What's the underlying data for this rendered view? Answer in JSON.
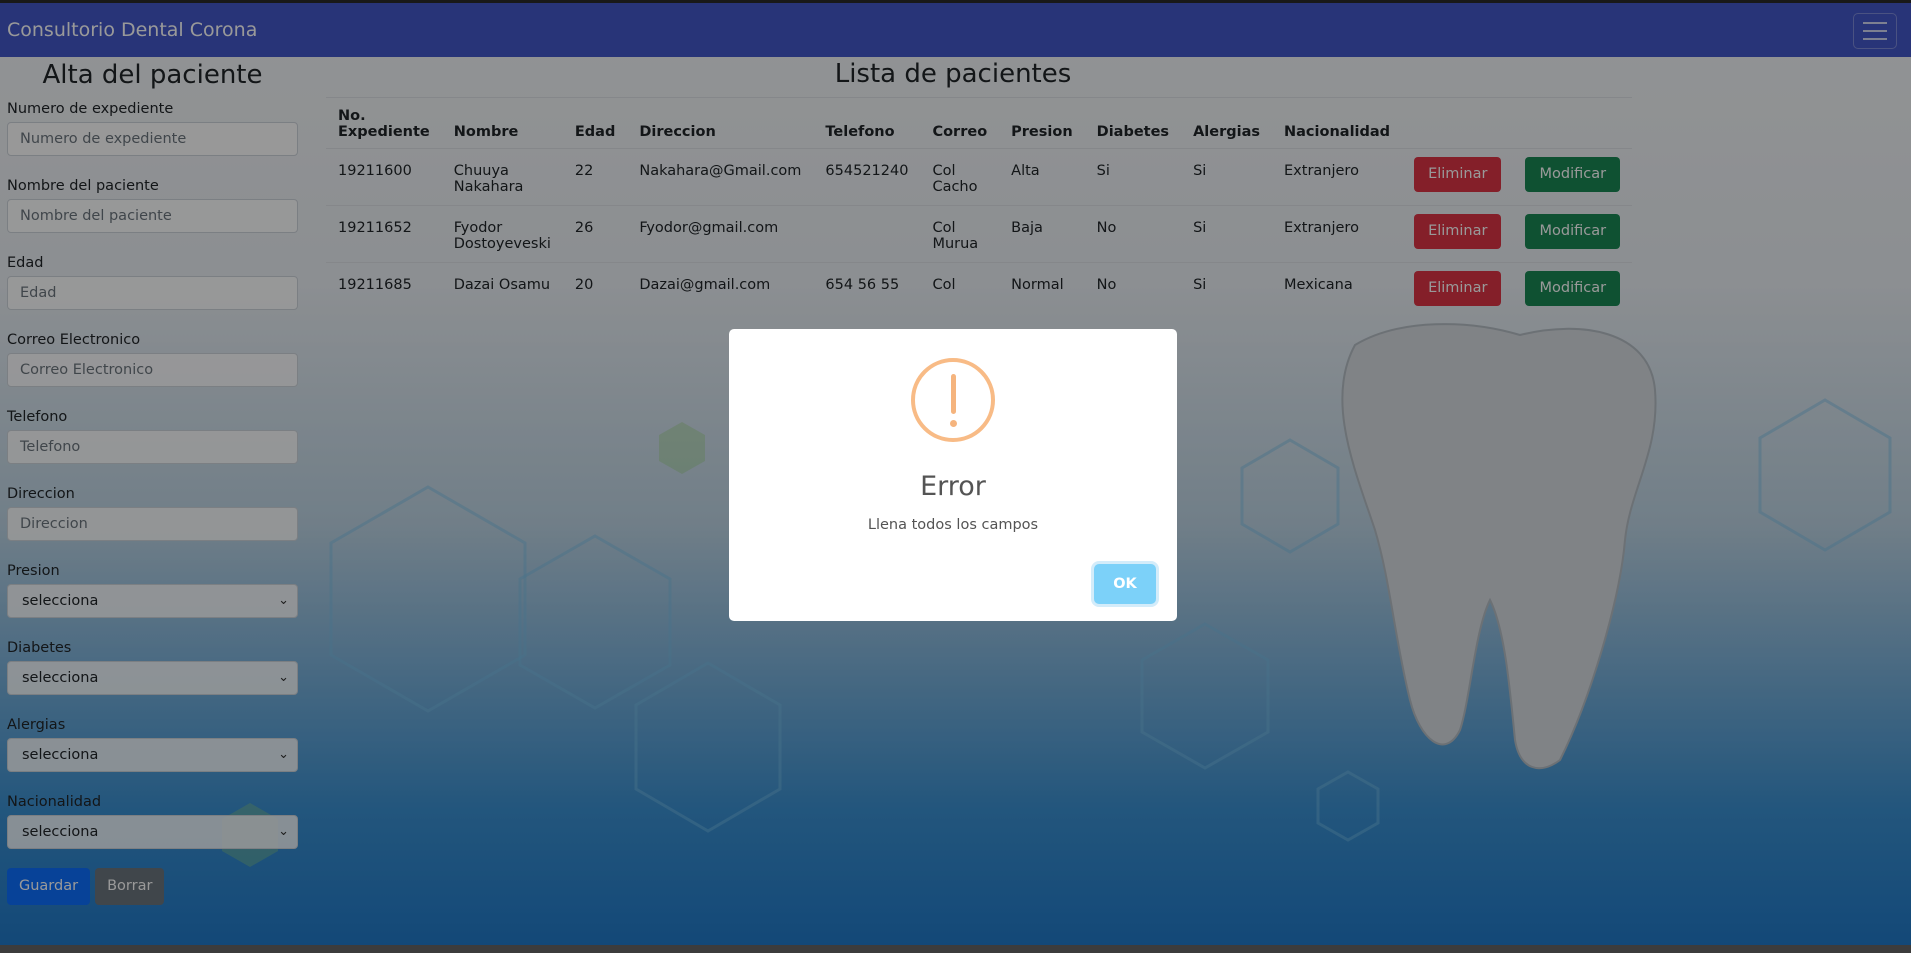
{
  "navbar": {
    "brand": "Consultorio Dental Corona"
  },
  "form": {
    "title": "Alta del paciente",
    "fields": [
      {
        "label": "Numero de expediente",
        "placeholder": "Numero de expediente"
      },
      {
        "label": "Nombre del paciente",
        "placeholder": "Nombre del paciente"
      },
      {
        "label": "Edad",
        "placeholder": "Edad"
      },
      {
        "label": "Correo Electronico",
        "placeholder": "Correo Electronico"
      },
      {
        "label": "Telefono",
        "placeholder": "Telefono"
      },
      {
        "label": "Direccion",
        "placeholder": "Direccion"
      }
    ],
    "selects": [
      {
        "label": "Presion",
        "value": "selecciona"
      },
      {
        "label": "Diabetes",
        "value": "selecciona"
      },
      {
        "label": "Alergias",
        "value": "selecciona"
      },
      {
        "label": "Nacionalidad",
        "value": "selecciona"
      }
    ],
    "save_label": "Guardar",
    "clear_label": "Borrar"
  },
  "list": {
    "title": "Lista de pacientes",
    "headers": [
      "No. Expediente",
      "Nombre",
      "Edad",
      "Direccion",
      "Telefono",
      "Correo",
      "Presion",
      "Diabetes",
      "Alergias",
      "Nacionalidad"
    ],
    "rows": [
      {
        "exp": "19211600",
        "nombre": "Chuuya Nakahara",
        "edad": "22",
        "direccion": "Nakahara@Gmail.com",
        "telefono": "654521240",
        "correo": "Col Cacho",
        "presion": "Alta",
        "diabetes": "Si",
        "alergias": "Si",
        "nacionalidad": "Extranjero"
      },
      {
        "exp": "19211652",
        "nombre": "Fyodor Dostoyeveski",
        "edad": "26",
        "direccion": "Fyodor@gmail.com",
        "telefono": "",
        "correo": "Col Murua",
        "presion": "Baja",
        "diabetes": "No",
        "alergias": "Si",
        "nacionalidad": "Extranjero"
      },
      {
        "exp": "19211685",
        "nombre": "Dazai Osamu",
        "edad": "20",
        "direccion": "Dazai@gmail.com",
        "telefono": "654 56 55",
        "correo": "Col",
        "presion": "Normal",
        "diabetes": "No",
        "alergias": "Si",
        "nacionalidad": "Mexicana"
      }
    ],
    "delete_label": "Eliminar",
    "edit_label": "Modificar"
  },
  "dialog": {
    "icon": "warning-icon",
    "title": "Error",
    "text": "Llena todos los campos",
    "ok_label": "OK"
  }
}
